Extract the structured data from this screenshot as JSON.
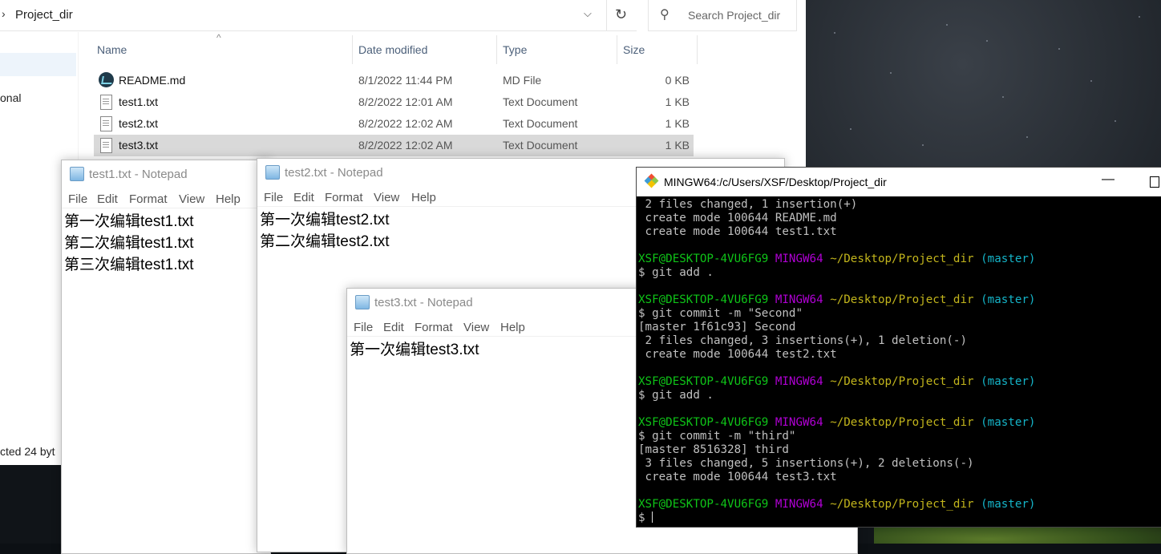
{
  "explorer": {
    "address_path": "Project_dir",
    "search_placeholder": "Search Project_dir",
    "nav_fragment": "onal",
    "status_fragment": "cted  24 byt",
    "columns": {
      "name": "Name",
      "date": "Date modified",
      "type": "Type",
      "size": "Size"
    },
    "files": [
      {
        "name": "README.md",
        "date": "8/1/2022 11:44 PM",
        "type": "MD File",
        "size": "0 KB"
      },
      {
        "name": "test1.txt",
        "date": "8/2/2022 12:01 AM",
        "type": "Text Document",
        "size": "1 KB"
      },
      {
        "name": "test2.txt",
        "date": "8/2/2022 12:02 AM",
        "type": "Text Document",
        "size": "1 KB"
      },
      {
        "name": "test3.txt",
        "date": "8/2/2022 12:02 AM",
        "type": "Text Document",
        "size": "1 KB",
        "selected": true
      }
    ]
  },
  "notepads": {
    "menu": {
      "file": "File",
      "edit": "Edit",
      "format": "Format",
      "view": "View",
      "help": "Help"
    },
    "test1": {
      "title": "test1.txt - Notepad",
      "content": "第一次编辑test1.txt\n第二次编辑test1.txt\n第三次编辑test1.txt"
    },
    "test2": {
      "title": "test2.txt - Notepad",
      "content": "第一次编辑test2.txt\n第二次编辑test2.txt"
    },
    "test3": {
      "title": "test3.txt - Notepad",
      "content": "第一次编辑test3.txt"
    }
  },
  "terminal": {
    "title": "MINGW64:/c/Users/XSF/Desktop/Project_dir",
    "prompt": {
      "user": "XSF@DESKTOP-4VU6FG9",
      "shell": "MINGW64",
      "path": "~/Desktop/Project_dir",
      "branch": "(master)"
    },
    "lines": [
      {
        "kind": "out",
        "text": " 2 files changed, 1 insertion(+)"
      },
      {
        "kind": "out",
        "text": " create mode 100644 README.md"
      },
      {
        "kind": "out",
        "text": " create mode 100644 test1.txt"
      },
      {
        "kind": "blank",
        "text": ""
      },
      {
        "kind": "prompt",
        "text": ""
      },
      {
        "kind": "out",
        "text": "$ git add ."
      },
      {
        "kind": "blank",
        "text": ""
      },
      {
        "kind": "prompt",
        "text": ""
      },
      {
        "kind": "out",
        "text": "$ git commit -m \"Second\""
      },
      {
        "kind": "out",
        "text": "[master 1f61c93] Second"
      },
      {
        "kind": "out",
        "text": " 2 files changed, 3 insertions(+), 1 deletion(-)"
      },
      {
        "kind": "out",
        "text": " create mode 100644 test2.txt"
      },
      {
        "kind": "blank",
        "text": ""
      },
      {
        "kind": "prompt",
        "text": ""
      },
      {
        "kind": "out",
        "text": "$ git add ."
      },
      {
        "kind": "blank",
        "text": ""
      },
      {
        "kind": "prompt",
        "text": ""
      },
      {
        "kind": "out",
        "text": "$ git commit -m \"third\""
      },
      {
        "kind": "out",
        "text": "[master 8516328] third"
      },
      {
        "kind": "out",
        "text": " 3 files changed, 5 insertions(+), 2 deletions(-)"
      },
      {
        "kind": "out",
        "text": " create mode 100644 test3.txt"
      },
      {
        "kind": "blank",
        "text": ""
      },
      {
        "kind": "prompt",
        "text": ""
      },
      {
        "kind": "input",
        "text": "$ "
      }
    ]
  }
}
